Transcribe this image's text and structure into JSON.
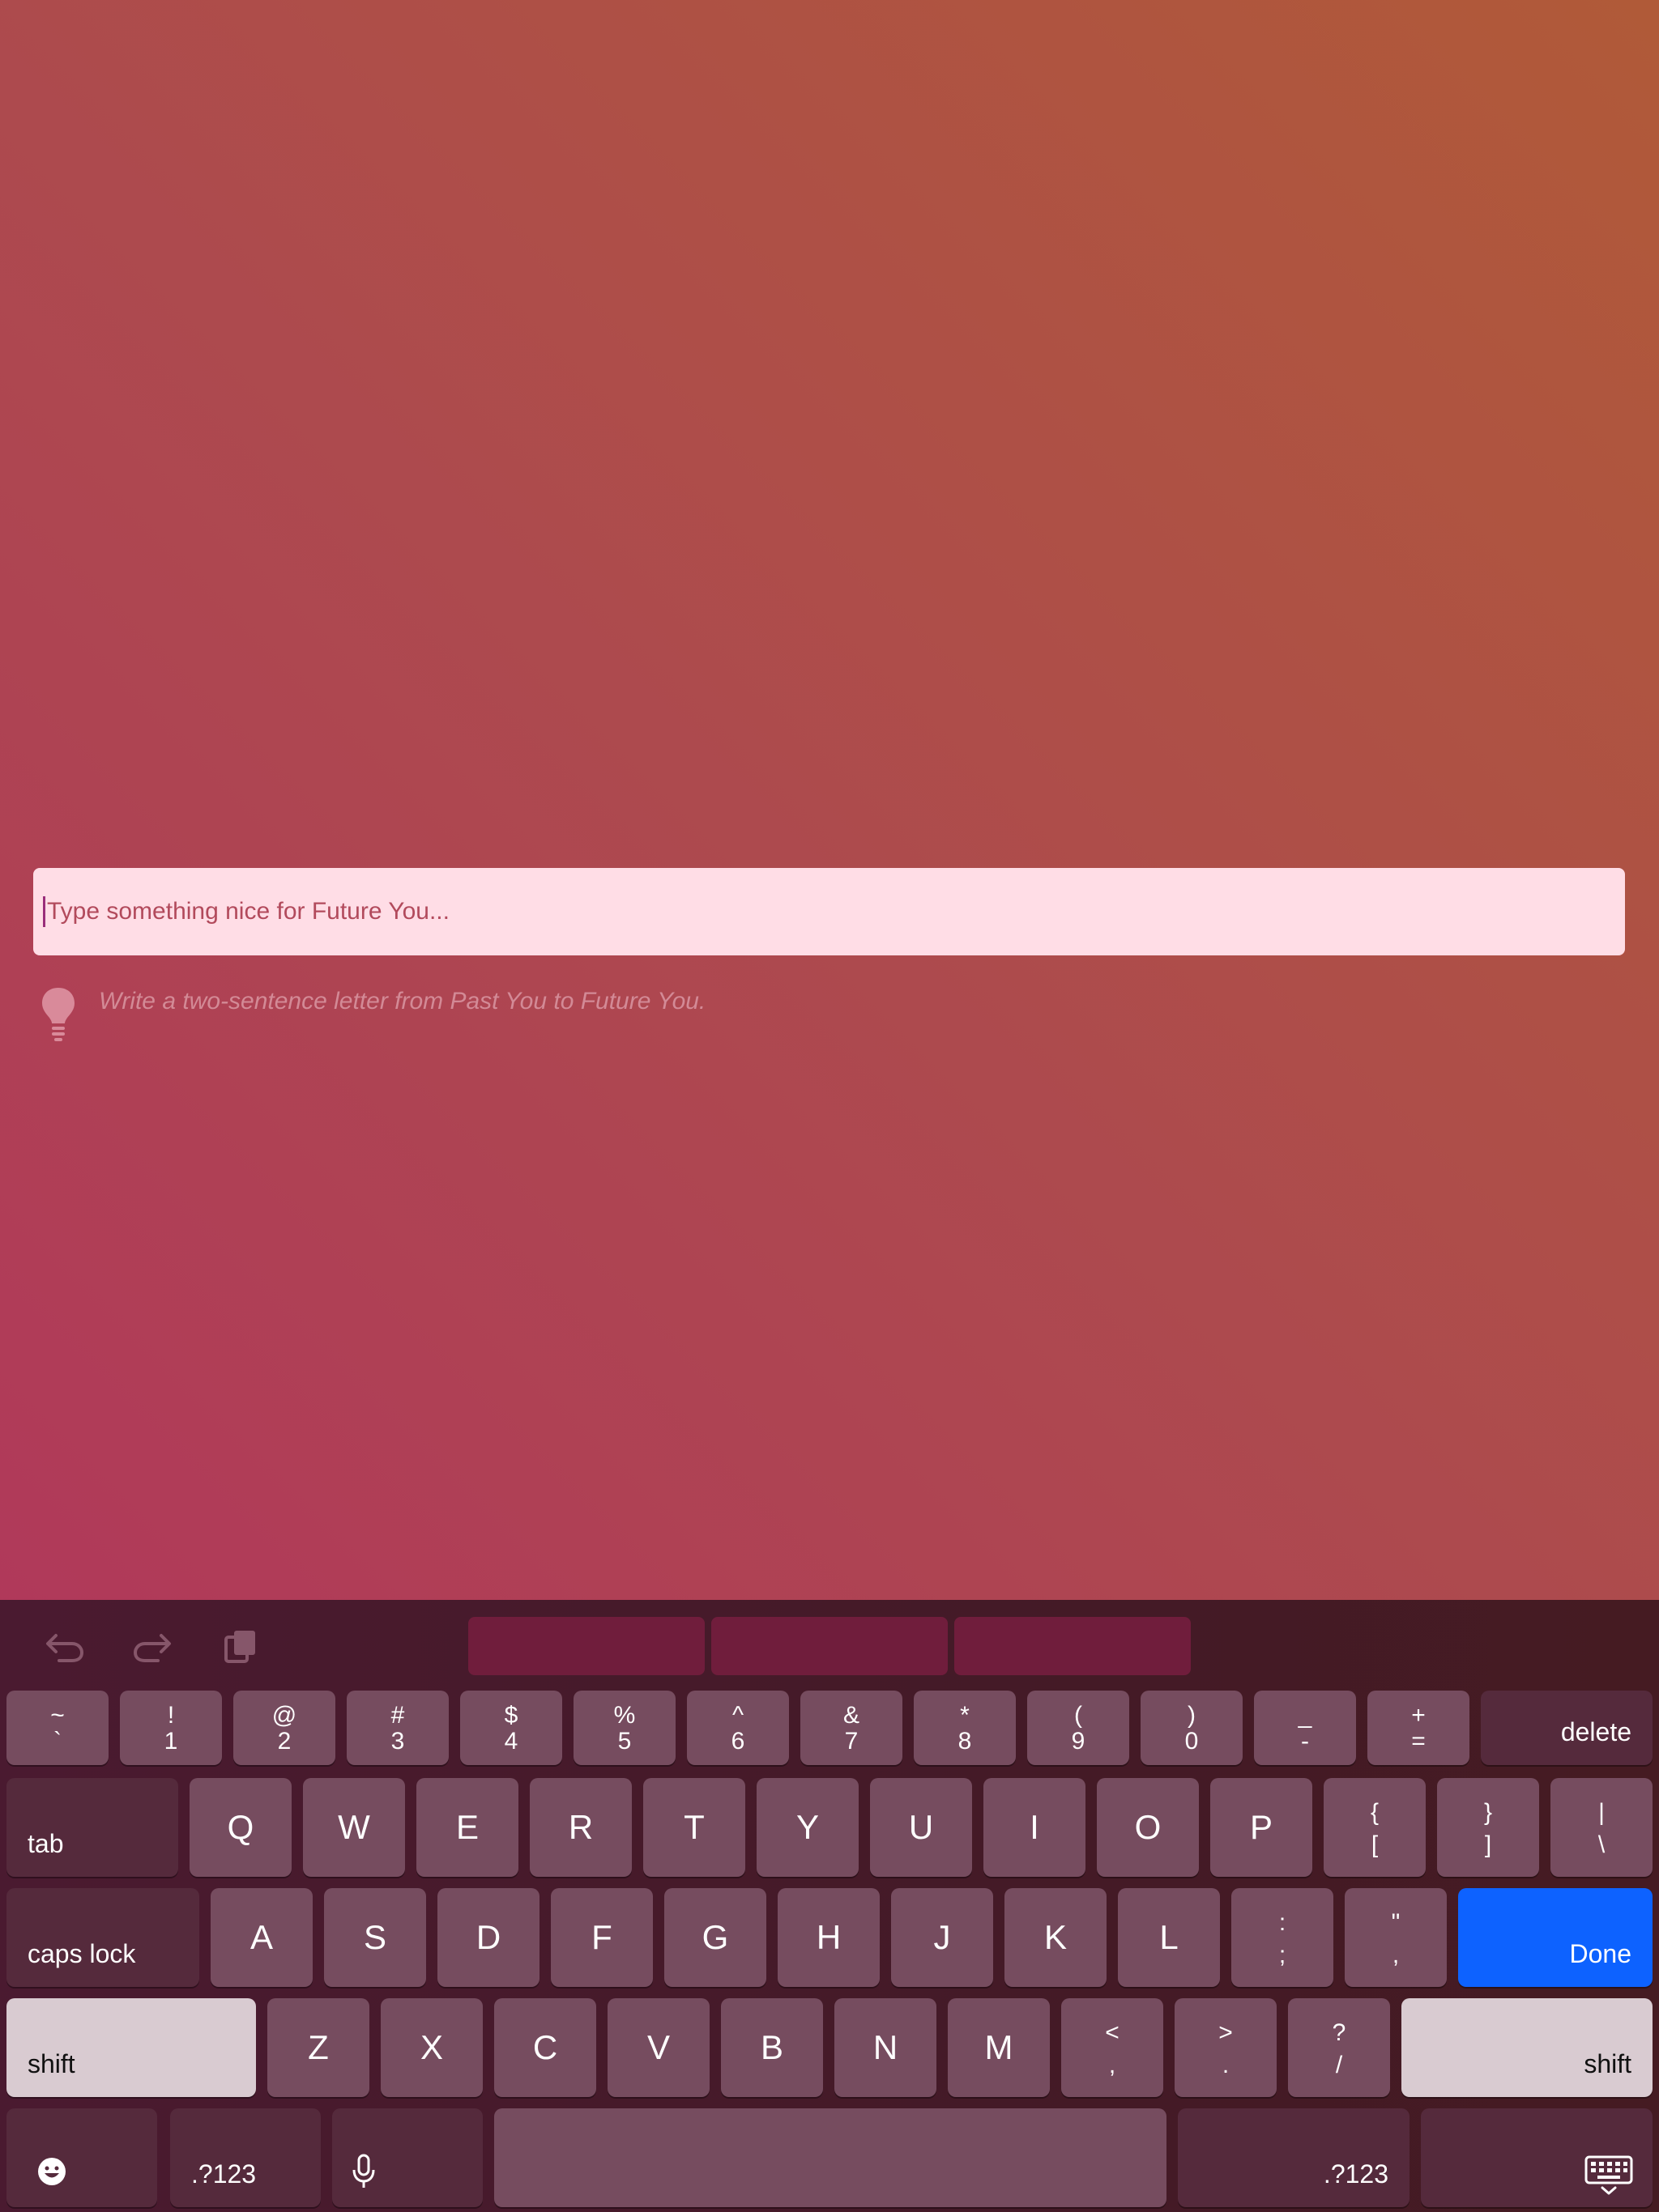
{
  "prompt": {
    "placeholder": "Type something nice for Future You...",
    "hint": "Write a two-sentence letter from Past You to Future You."
  },
  "keyboard": {
    "toolbar": {
      "undo": "undo-icon",
      "redo": "redo-icon",
      "paste": "paste-icon"
    },
    "suggestions": [
      "",
      "",
      ""
    ],
    "row1": [
      {
        "top": "~",
        "bot": "`"
      },
      {
        "top": "!",
        "bot": "1"
      },
      {
        "top": "@",
        "bot": "2"
      },
      {
        "top": "#",
        "bot": "3"
      },
      {
        "top": "$",
        "bot": "4"
      },
      {
        "top": "%",
        "bot": "5"
      },
      {
        "top": "^",
        "bot": "6"
      },
      {
        "top": "&",
        "bot": "7"
      },
      {
        "top": "*",
        "bot": "8"
      },
      {
        "top": "(",
        "bot": "9"
      },
      {
        "top": ")",
        "bot": "0"
      },
      {
        "top": "_",
        "bot": "-"
      },
      {
        "top": "+",
        "bot": "="
      }
    ],
    "delete": "delete",
    "tab": "tab",
    "row2": [
      "Q",
      "W",
      "E",
      "R",
      "T",
      "Y",
      "U",
      "I",
      "O",
      "P"
    ],
    "row2_symbols": [
      {
        "top": "{",
        "bot": "["
      },
      {
        "top": "}",
        "bot": "]"
      },
      {
        "top": "|",
        "bot": "\\"
      }
    ],
    "caps_lock": "caps lock",
    "row3": [
      "A",
      "S",
      "D",
      "F",
      "G",
      "H",
      "J",
      "K",
      "L"
    ],
    "row3_symbols": [
      {
        "top": ":",
        "bot": ";"
      },
      {
        "top": "\"",
        "bot": ","
      }
    ],
    "done": "Done",
    "shift": "shift",
    "row4": [
      "Z",
      "X",
      "C",
      "V",
      "B",
      "N",
      "M"
    ],
    "row4_symbols": [
      {
        "top": "<",
        "bot": ","
      },
      {
        "top": ">",
        "bot": "."
      },
      {
        "top": "?",
        "bot": "/"
      }
    ],
    "numbers": ".?123",
    "icons": {
      "emoji": "emoji-icon",
      "mic": "microphone-icon",
      "dismiss": "keyboard-dismiss-icon",
      "hint": "lightbulb-icon"
    },
    "colors": {
      "key": "#764c5f",
      "dark_key": "#552a3c",
      "shift_key": "#d9cbd1",
      "done_key": "#0d62ff"
    }
  }
}
